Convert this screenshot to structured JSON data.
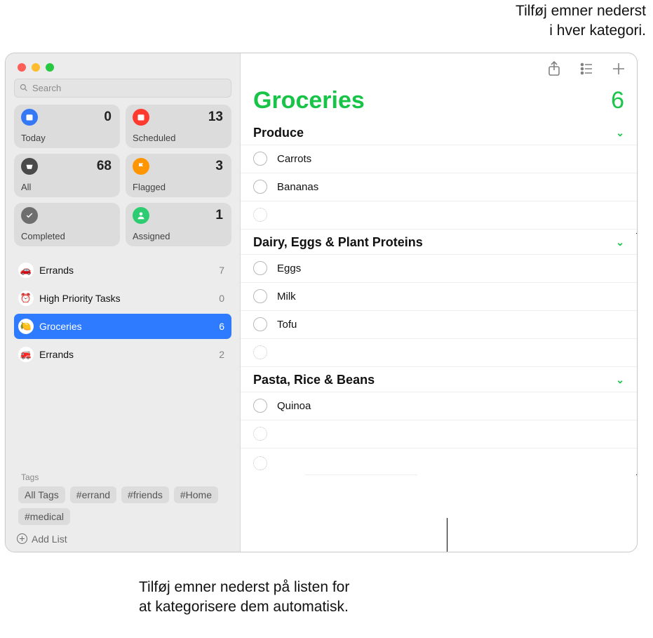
{
  "callouts": {
    "top_line1": "Tilføj emner nederst",
    "top_line2": "i hver kategori.",
    "bottom_line1": "Tilføj emner nederst på listen for",
    "bottom_line2": "at kategorisere dem automatisk."
  },
  "search": {
    "placeholder": "Search"
  },
  "smartLists": {
    "today": {
      "label": "Today",
      "count": "0",
      "color": "#3478f6"
    },
    "scheduled": {
      "label": "Scheduled",
      "count": "13",
      "color": "#ff3b30"
    },
    "all": {
      "label": "All",
      "count": "68",
      "color": "#4a4a4a"
    },
    "flagged": {
      "label": "Flagged",
      "count": "3",
      "color": "#ff9500"
    },
    "completed": {
      "label": "Completed",
      "count": "",
      "color": "#6e6e6e"
    },
    "assigned": {
      "label": "Assigned",
      "count": "1",
      "color": "#2ecc71"
    }
  },
  "lists": [
    {
      "emoji": "🚗",
      "name": "Errands",
      "count": "7",
      "selected": false
    },
    {
      "emoji": "⏰",
      "name": "High Priority Tasks",
      "count": "0",
      "selected": false
    },
    {
      "emoji": "🍋",
      "name": "Groceries",
      "count": "6",
      "selected": true
    },
    {
      "emoji": "🚒",
      "name": "Errands",
      "count": "2",
      "selected": false
    }
  ],
  "tags": {
    "header": "Tags",
    "items": [
      "All Tags",
      "#errand",
      "#friends",
      "#Home",
      "#medical"
    ]
  },
  "addList": {
    "label": "Add List"
  },
  "main": {
    "title": "Groceries",
    "count": "6",
    "sections": [
      {
        "title": "Produce",
        "items": [
          "Carrots",
          "Bananas"
        ]
      },
      {
        "title": "Dairy, Eggs & Plant Proteins",
        "items": [
          "Eggs",
          "Milk",
          "Tofu"
        ]
      },
      {
        "title": "Pasta, Rice & Beans",
        "items": [
          "Quinoa"
        ]
      }
    ]
  }
}
